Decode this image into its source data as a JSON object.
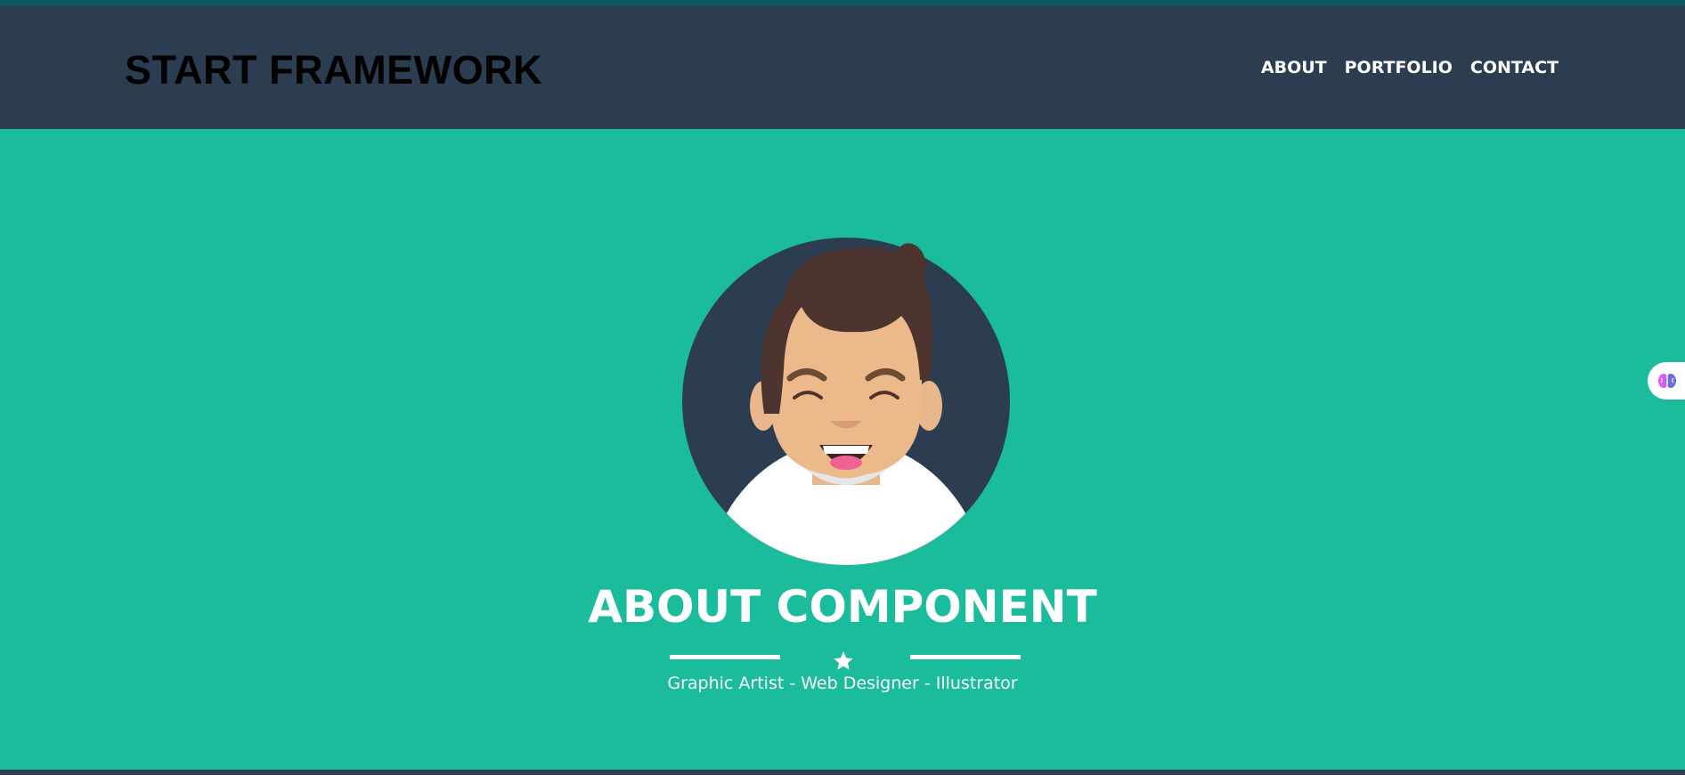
{
  "navbar": {
    "brand": "START FRAMEWORK",
    "links": [
      {
        "label": "ABOUT"
      },
      {
        "label": "PORTFOLIO"
      },
      {
        "label": "CONTACT"
      }
    ]
  },
  "hero": {
    "avatar_icon": "smiling-man-avatar",
    "title": "ABOUT COMPONENT",
    "divider_icon": "star-icon",
    "subtitle": "Graphic Artist - Web Designer - Illustrator"
  },
  "extension": {
    "icon": "brain-icon"
  },
  "colors": {
    "navbar_bg": "#2d3d51",
    "hero_bg": "#1abc9c",
    "accent_dark": "#2c3e50",
    "text_light": "#ffffff"
  }
}
